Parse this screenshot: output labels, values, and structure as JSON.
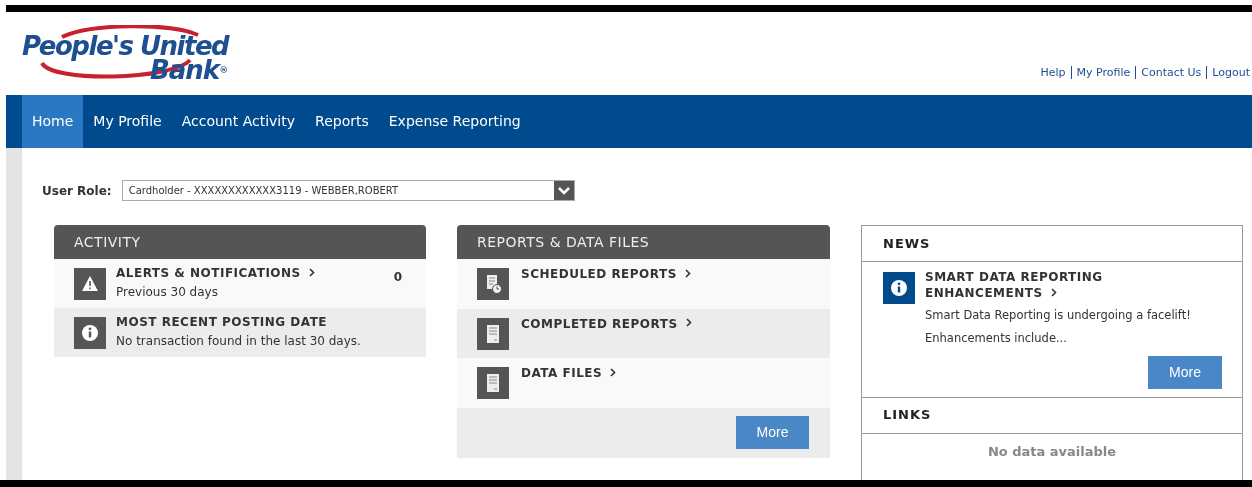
{
  "logo": {
    "line_1": "People's United",
    "line_2": "Bank",
    "mark": "®"
  },
  "top_links": [
    "Help",
    "My Profile",
    "Contact Us",
    "Logout"
  ],
  "tabs": [
    {
      "label": "Home",
      "selected": true
    },
    {
      "label": "My Profile",
      "selected": false
    },
    {
      "label": "Account Activity",
      "selected": false
    },
    {
      "label": "Reports",
      "selected": false
    },
    {
      "label": "Expense Reporting",
      "selected": false
    }
  ],
  "user_role": {
    "label": "User Role:",
    "value": "Cardholder - XXXXXXXXXXXX3119 - WEBBER,ROBERT"
  },
  "activity": {
    "title": "ACTIVITY",
    "items": [
      {
        "kind": "alert",
        "title": "ALERTS & NOTIFICATIONS",
        "link": true,
        "subtitle": "Previous 30 days",
        "count": "0"
      },
      {
        "kind": "info",
        "title": "MOST RECENT POSTING DATE",
        "link": false,
        "subtitle": "No transaction found in the last 30 days."
      }
    ]
  },
  "reports": {
    "title": "REPORTS & DATA FILES",
    "items": [
      {
        "kind": "scheduled",
        "title": "SCHEDULED REPORTS"
      },
      {
        "kind": "document",
        "title": "COMPLETED REPORTS"
      },
      {
        "kind": "document",
        "title": "DATA FILES"
      }
    ],
    "button": "More"
  },
  "news": {
    "title": "NEWS",
    "items": [
      {
        "title": "SMART DATA REPORTING ENHANCEMENTS",
        "lines": [
          "Smart Data Reporting is undergoing a facelift!",
          "Enhancements include..."
        ]
      }
    ],
    "button": "More"
  },
  "links": {
    "title": "LINKS",
    "empty_text": "No data available"
  }
}
